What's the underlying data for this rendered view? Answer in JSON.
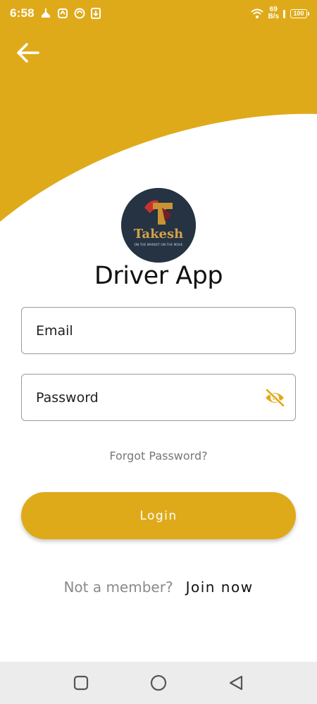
{
  "status_bar": {
    "time": "6:58",
    "net_speed_value": "69",
    "net_speed_unit": "B/s",
    "battery": "100",
    "left_icons": [
      "hand-wash-icon",
      "sync-icon",
      "vpn-icon",
      "download-icon"
    ],
    "right_icons": [
      "wifi-icon",
      "signal-icon",
      "battery-icon"
    ]
  },
  "header": {
    "accent_color": "#dfaa1a",
    "back_icon": "arrow-left-icon"
  },
  "logo": {
    "text": "Takesh",
    "tagline": "ON THE MARKET ON THE MOVE",
    "icon": "company-logo"
  },
  "title": "Driver App",
  "form": {
    "email_placeholder": "Email",
    "password_placeholder": "Password",
    "password_toggle_icon": "eye-off-icon",
    "forgot_password": "Forgot Password?",
    "login_label": "Login"
  },
  "signup": {
    "prompt": "Not a member?",
    "link": "Join now"
  },
  "nav_bar": {
    "icons": [
      "recents-square-icon",
      "home-circle-icon",
      "back-triangle-icon"
    ]
  }
}
